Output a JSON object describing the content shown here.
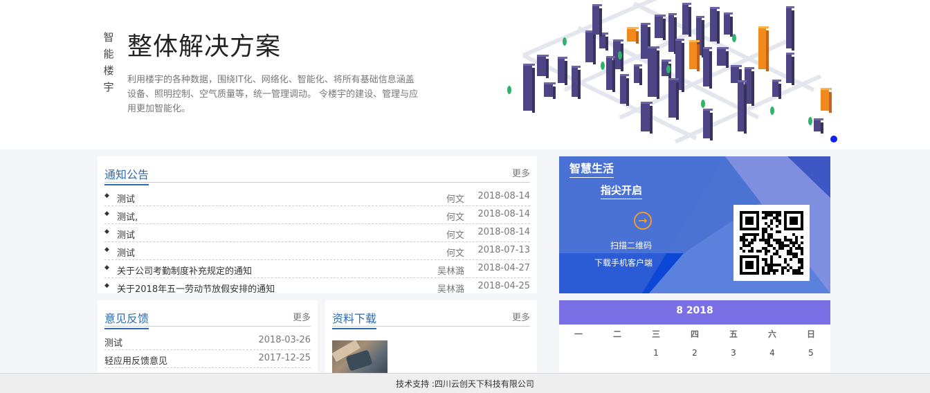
{
  "banner": {
    "side_chars": [
      "智",
      "能",
      "楼",
      "宇"
    ],
    "title": "整体解决方案",
    "description": "利用楼宇的各种数据，围绕IT化、网络化、智能化、将所有基础信息涵盖设备、照明控制、空气质量等，统一管理调动。 令楼宇的建设、管理与应用更加智能化。"
  },
  "notice": {
    "title": "通知公告",
    "more": "更多",
    "items": [
      {
        "title": "测试",
        "author": "何文",
        "date": "2018-08-14"
      },
      {
        "title": "测试,",
        "author": "何文",
        "date": "2018-08-14"
      },
      {
        "title": "测试",
        "author": "何文",
        "date": "2018-08-14"
      },
      {
        "title": "测试",
        "author": "何文",
        "date": "2018-07-13"
      },
      {
        "title": "关于公司考勤制度补充规定的通知",
        "author": "吴林潞",
        "date": "2018-04-27"
      },
      {
        "title": "关于2018年五一劳动节放假安排的通知",
        "author": "吴林潞",
        "date": "2018-04-25"
      }
    ]
  },
  "feedback": {
    "title": "意见反馈",
    "more": "更多",
    "items": [
      {
        "title": "测试",
        "date": "2018-03-26"
      },
      {
        "title": "轻应用反馈意见",
        "date": "2017-12-25"
      }
    ]
  },
  "download": {
    "title": "资料下载",
    "more": "更多"
  },
  "smart": {
    "title": "智慧生活",
    "subtitle": "指尖开启",
    "scan": "扫描二维码",
    "download": "下载手机客户端"
  },
  "calendar": {
    "header": "8  2018",
    "weekdays": [
      "一",
      "二",
      "三",
      "四",
      "五",
      "六",
      "日"
    ],
    "first_row": [
      "",
      "",
      "1",
      "2",
      "3",
      "4",
      "5"
    ]
  },
  "footer": {
    "text": "技术支持 :四川云创天下科技有限公司"
  },
  "colors": {
    "accent": "#2d6bb0",
    "calendar_header": "#7b6fe6",
    "smart_bg": "#4b73d4",
    "orange": "#f29a2e"
  }
}
